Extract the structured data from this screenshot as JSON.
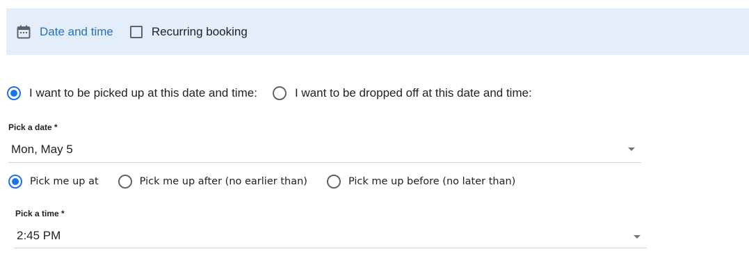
{
  "header": {
    "title": "Date and time",
    "calendar_icon": "calendar-icon",
    "recurring_label": "Recurring booking",
    "recurring_checked": false,
    "background": "#e3eefa",
    "title_color": "#2a6fb6"
  },
  "mode": {
    "options": [
      {
        "label": "I want to be picked up at this date and time:",
        "checked": true
      },
      {
        "label": "I want to be dropped off at this date and time:",
        "checked": false
      }
    ]
  },
  "date_field": {
    "label": "Pick a date *",
    "value": "Mon, May 5",
    "icon": "chevron-down-icon"
  },
  "pickup_type": {
    "options": [
      {
        "label": "Pick me up at",
        "checked": true
      },
      {
        "label": "Pick me up after (no earlier than)",
        "checked": false
      },
      {
        "label": "Pick me up before (no later than)",
        "checked": false
      }
    ]
  },
  "time_field": {
    "label": "Pick a time *",
    "value": "2:45 PM",
    "icon": "chevron-down-icon"
  },
  "accent_color": "#1a73e8"
}
